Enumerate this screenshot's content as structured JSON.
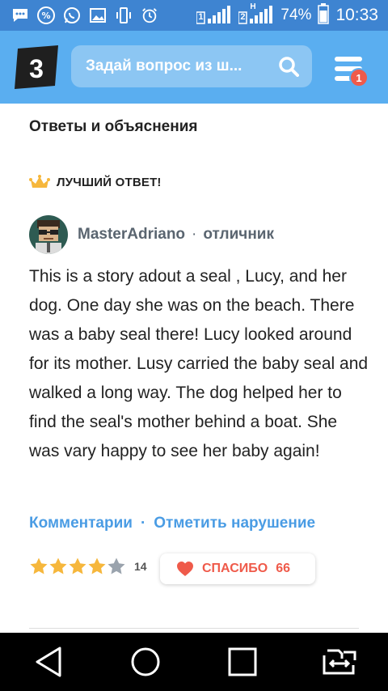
{
  "status_bar": {
    "battery_percent": "74%",
    "time": "10:33",
    "icons": [
      "message-icon",
      "percent-icon",
      "whatsapp-icon",
      "image-icon",
      "vibrate-icon",
      "alarm-icon",
      "signal-sim1-icon",
      "signal-sim2-icon",
      "battery-icon"
    ],
    "sim1_label": "1",
    "sim2_label": "2",
    "sim2_network": "H"
  },
  "header": {
    "logo_text": "3",
    "search_placeholder": "Задай вопрос из ш...",
    "notification_count": "1",
    "bg_color": "#5aaef0"
  },
  "content": {
    "section_title": "Ответы и объяснения",
    "best_label": "ЛУЧШИЙ ОТВЕТ!",
    "author_name": "MasterAdriano",
    "author_sep": "·",
    "author_rank": "отличник",
    "answer_text": "This is a story adout a  seal , Lucy, and her dog. One day she was on the beach. There was a baby seal there! Lucy looked around for its mother. Lusy carried the baby seal and walked a long way. The dog helped her to find the seal's mother behind a boat. She was vary happy to see her baby again!",
    "comments_link": "Комментарии",
    "actions_sep": "·",
    "report_link": "Отметить нарушение",
    "rating_stars": 4,
    "rating_count": "14",
    "thanks_label": "СПАСИБО",
    "thanks_count": "66",
    "accent_color": "#4a9ce4",
    "thanks_color": "#ef5a4a"
  },
  "nav_bar": {
    "buttons": [
      "back-icon",
      "home-icon",
      "recents-icon",
      "switch-sim-icon"
    ]
  }
}
